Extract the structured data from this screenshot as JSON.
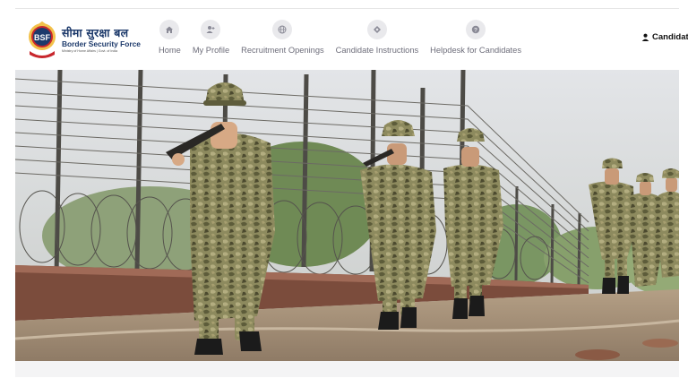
{
  "brand": {
    "logo_text": "BSF",
    "name_hindi": "सीमा सुरक्षा बल",
    "name_english": "Border Security Force",
    "ministry": "Ministry of Home Affairs | Govt. of India"
  },
  "nav": {
    "items": [
      {
        "label": "Home",
        "icon": "home-icon"
      },
      {
        "label": "My Profile",
        "icon": "user-plus-icon"
      },
      {
        "label": "Recruitment Openings",
        "icon": "globe-icon"
      },
      {
        "label": "Candidate Instructions",
        "icon": "diamond-icon"
      },
      {
        "label": "Helpdesk for Candidates",
        "icon": "question-icon"
      }
    ]
  },
  "user": {
    "label": "Candidate",
    "icon": "user-icon"
  },
  "hero": {
    "description_icon": "hero-image",
    "colors": {
      "sky": "#dcdfe3",
      "ground": "#a58f7a",
      "camo": "#7b7a52"
    }
  },
  "colors": {
    "brand_blue": "#1d3a6b",
    "nav_text": "#6d6d7a",
    "nav_icon_bg": "#e9e9ec",
    "logo_red": "#c8272d"
  }
}
